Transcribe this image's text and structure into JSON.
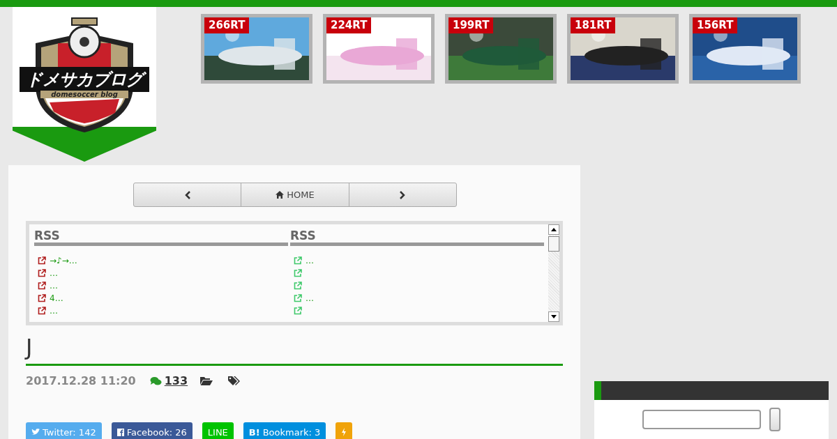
{
  "logo": {
    "title": "ドメサカブログ",
    "subtitle": "domesoccer blog"
  },
  "ranking": [
    {
      "count": "266RT"
    },
    {
      "count": "224RT"
    },
    {
      "count": "199RT"
    },
    {
      "count": "181RT"
    },
    {
      "count": "156RT"
    }
  ],
  "nav": {
    "home": "HOME"
  },
  "feeds": [
    {
      "heading": "RSS",
      "color": "#b01c1c",
      "items": [
        {
          "kind": "link",
          "text": "→♪→…"
        },
        {
          "kind": "link",
          "text": "…"
        },
        {
          "kind": "link",
          "text": "…"
        },
        {
          "kind": "link",
          "text": "4…"
        },
        {
          "kind": "link",
          "text": "…"
        }
      ]
    },
    {
      "heading": "RSS",
      "color": "#3ec96a",
      "items": [
        {
          "kind": "link",
          "text": "…"
        },
        {
          "kind": "icon"
        },
        {
          "kind": "icon"
        },
        {
          "kind": "link",
          "text": "…"
        },
        {
          "kind": "icon"
        }
      ]
    }
  ],
  "article": {
    "title": "J",
    "date": "2017.12.28 11:20",
    "comments": "133"
  },
  "share": [
    {
      "kind": "twitter",
      "label": "Twitter: 142"
    },
    {
      "kind": "facebook",
      "label": "Facebook: 26"
    },
    {
      "kind": "line",
      "label": "LINE"
    },
    {
      "kind": "hatena",
      "label": "Bookmark: 3",
      "prefix": "B!"
    },
    {
      "kind": "pocket"
    }
  ]
}
